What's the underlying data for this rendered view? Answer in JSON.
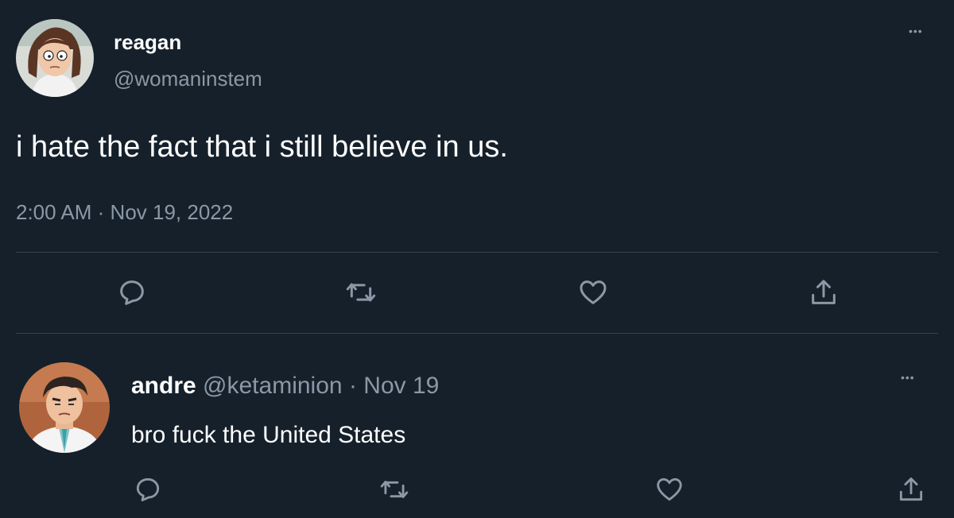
{
  "tweet": {
    "author": {
      "display_name": "reagan",
      "handle": "@womaninstem",
      "avatar_icon": "cartoon-woman-avatar-icon"
    },
    "text": "i hate the fact that i still believe in us.",
    "time": "2:00 AM",
    "separator": "·",
    "date": "Nov 19, 2022",
    "more_label": "•••",
    "actions": [
      "reply-icon",
      "retweet-icon",
      "like-icon",
      "share-icon"
    ]
  },
  "reply": {
    "author": {
      "display_name": "andre",
      "handle": "@ketaminion",
      "avatar_icon": "cartoon-doctor-avatar-icon"
    },
    "separator": "·",
    "date": "Nov 19",
    "text": "bro fuck the United States",
    "more_label": "•••",
    "actions": [
      "reply-icon",
      "retweet-icon",
      "like-icon",
      "share-icon"
    ]
  },
  "colors": {
    "background": "#15202b",
    "text": "#ffffff",
    "muted": "#8b98a5",
    "divider": "#38444d"
  }
}
